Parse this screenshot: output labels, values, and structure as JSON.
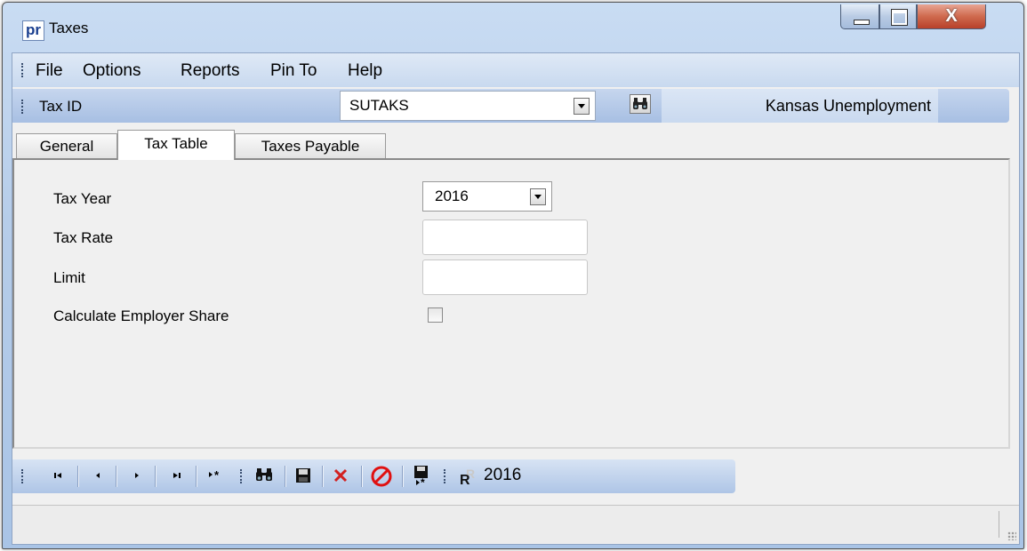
{
  "window": {
    "title": "Taxes",
    "logo_text": "pr",
    "controls": {
      "minimize": "minimize",
      "maximize": "maximize",
      "close": "X"
    }
  },
  "menu": {
    "items": [
      "File",
      "Options",
      "Reports",
      "Pin To",
      "Help"
    ]
  },
  "taxbar": {
    "label": "Tax ID",
    "selected_value": "SUTAKS",
    "find_icon": "binoculars-icon",
    "tax_name": "Kansas Unemployment"
  },
  "tabs": [
    "General",
    "Tax Table",
    "Taxes Payable"
  ],
  "active_tab": "Tax Table",
  "form": {
    "tax_year_label": "Tax Year",
    "tax_year_value": "2016",
    "tax_rate_label": "Tax Rate",
    "tax_rate_value": "",
    "limit_label": "Limit",
    "limit_value": "",
    "calc_employer_label": "Calculate Employer Share",
    "calc_employer_checked": false
  },
  "navbar": {
    "buttons": [
      {
        "name": "first-record-icon",
        "glyph": "⏮"
      },
      {
        "name": "previous-record-icon",
        "glyph": "◀"
      },
      {
        "name": "next-record-icon",
        "glyph": "▶"
      },
      {
        "name": "last-record-icon",
        "glyph": "⏭"
      },
      {
        "name": "new-record-icon",
        "glyph": "▸*"
      },
      {
        "name": "find-icon",
        "glyph": "binoculars"
      },
      {
        "name": "save-icon",
        "glyph": "floppy"
      },
      {
        "name": "delete-icon",
        "glyph": "✕"
      },
      {
        "name": "cancel-icon",
        "glyph": "⊘"
      },
      {
        "name": "save-new-icon",
        "glyph": "floppy-star"
      },
      {
        "name": "report-icon",
        "glyph": "R"
      }
    ],
    "year": "2016"
  },
  "colors": {
    "accent_red": "#c0392b",
    "delete_red": "#d22020",
    "cancel_red": "#e01010"
  }
}
